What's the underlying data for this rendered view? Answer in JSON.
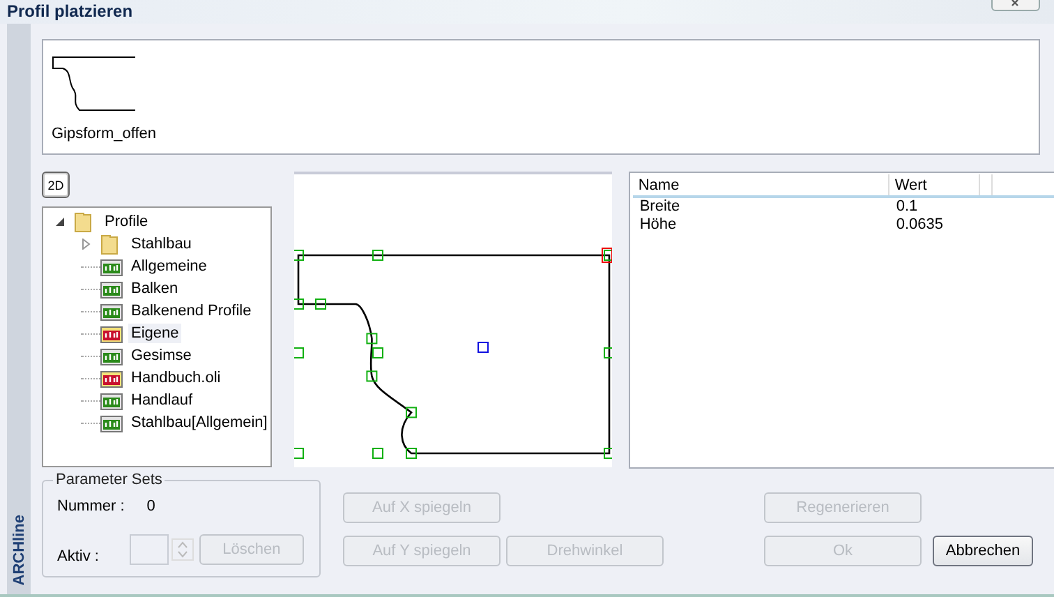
{
  "window": {
    "title": "Profil platzieren"
  },
  "preview": {
    "items": [
      {
        "label": "Gipsform_offen"
      }
    ]
  },
  "view_toggle": {
    "label": "2D"
  },
  "tree": [
    {
      "label": "Profile",
      "kind": "folder",
      "expanded": true,
      "selected": false,
      "children": [
        {
          "label": "Stahlbau",
          "kind": "folder",
          "expanded": false,
          "selected": false
        },
        {
          "label": "Allgemeine",
          "kind": "library",
          "selected": false
        },
        {
          "label": "Balken",
          "kind": "library",
          "selected": false
        },
        {
          "label": "Balkenend Profile",
          "kind": "library",
          "selected": false
        },
        {
          "label": "Eigene",
          "kind": "user-library",
          "selected": true
        },
        {
          "label": "Gesimse",
          "kind": "library",
          "selected": false
        },
        {
          "label": "Handbuch.oli",
          "kind": "user-library",
          "selected": false
        },
        {
          "label": "Handlauf",
          "kind": "library",
          "selected": false
        },
        {
          "label": "Stahlbau[Allgemein]",
          "kind": "library",
          "selected": false
        }
      ]
    }
  ],
  "properties": {
    "columns": [
      "Name",
      "Wert"
    ],
    "rows": [
      [
        "Breite",
        "0.1"
      ],
      [
        "Höhe",
        "0.0635"
      ]
    ]
  },
  "parameter_sets": {
    "title": "Parameter Sets",
    "number_label": "Nummer :",
    "number_value": "0",
    "active_label": "Aktiv :",
    "delete_button": {
      "label": "Löschen",
      "disabled": true
    }
  },
  "buttons": [
    {
      "label": "Auf X spiegeln",
      "disabled": true
    },
    {
      "label": "Regenerieren",
      "disabled": true
    },
    {
      "label": "Auf Y spiegeln",
      "disabled": true
    },
    {
      "label": "Drehwinkel",
      "disabled": true
    },
    {
      "label": "Ok",
      "disabled": true
    },
    {
      "label": "Abbrechen",
      "disabled": false
    }
  ],
  "side_label": "ARCHline"
}
